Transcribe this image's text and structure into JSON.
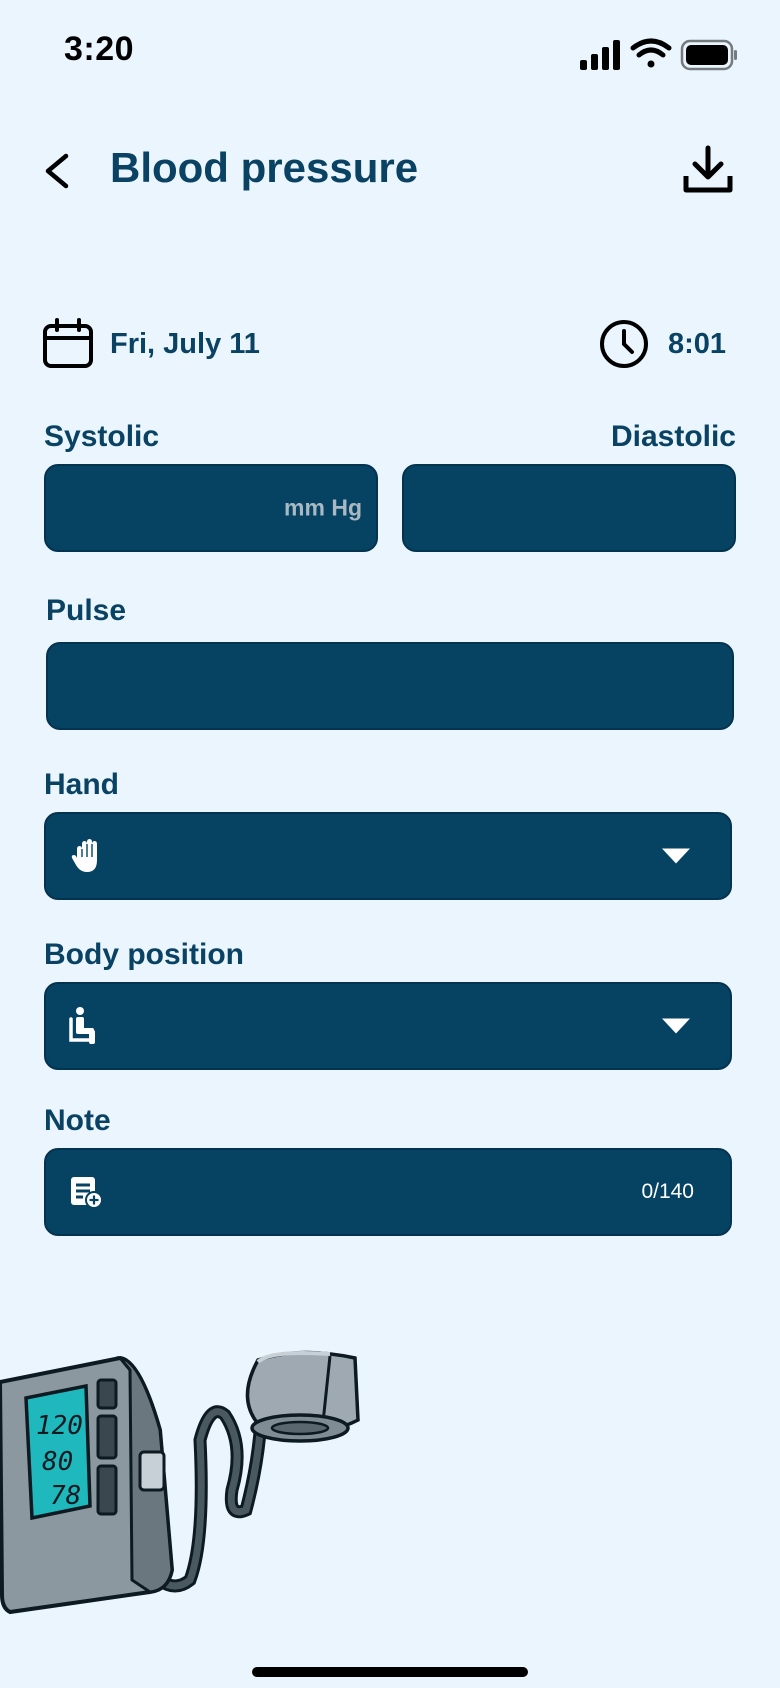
{
  "status_bar": {
    "time": "3:20"
  },
  "header": {
    "title": "Blood pressure"
  },
  "datetime": {
    "date": "Fri, July 11",
    "time": "8:01"
  },
  "systolic": {
    "label": "Systolic",
    "unit": "mm Hg",
    "value": ""
  },
  "diastolic": {
    "label": "Diastolic",
    "value": ""
  },
  "pulse": {
    "label": "Pulse",
    "value": ""
  },
  "hand": {
    "label": "Hand",
    "selected": ""
  },
  "body_position": {
    "label": "Body position",
    "selected": ""
  },
  "note": {
    "label": "Note",
    "counter": "0/140"
  },
  "illustration": {
    "display": [
      "120",
      "80",
      "78"
    ]
  },
  "colors": {
    "background": "#eaf5fd",
    "primary": "#0a4263",
    "field": "#064262",
    "screen": "#1fb8bd"
  }
}
